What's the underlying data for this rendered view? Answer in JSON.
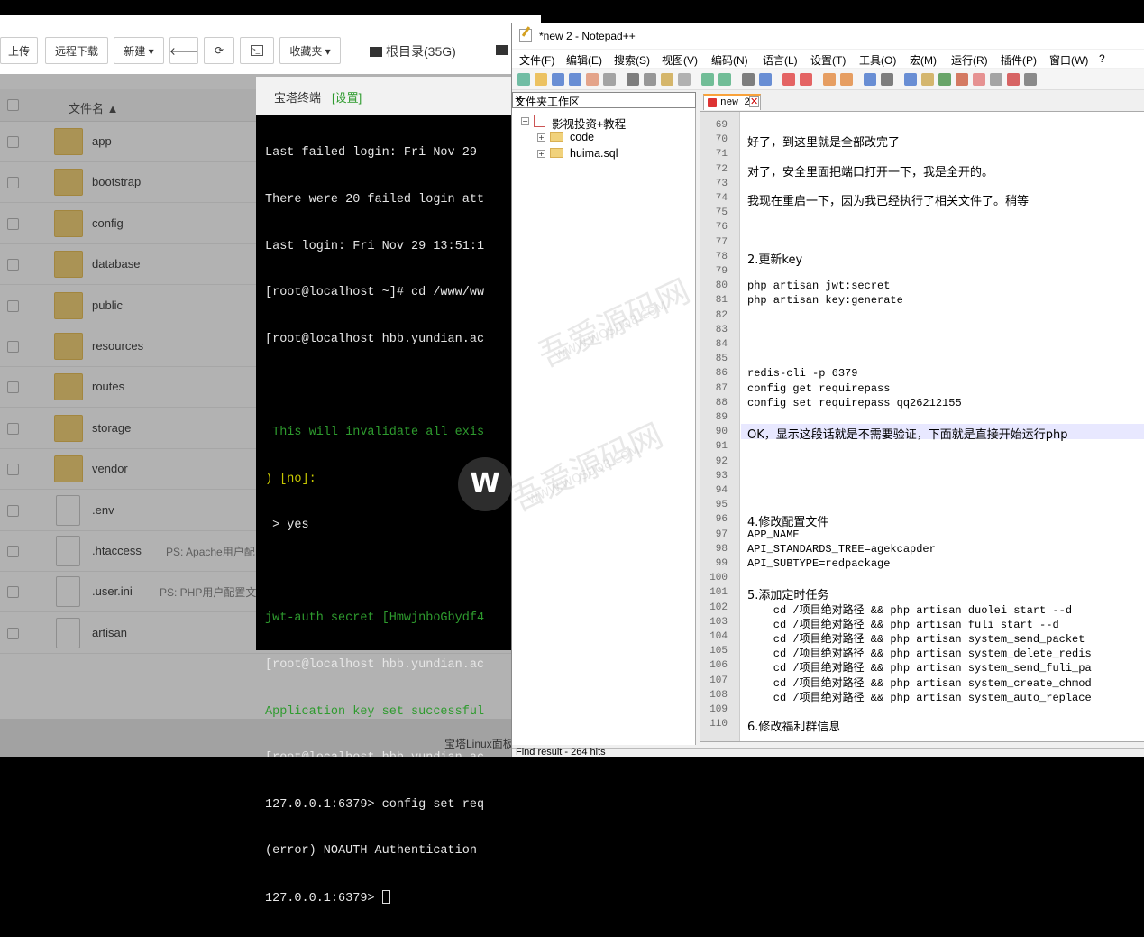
{
  "file_manager": {
    "toolbar": {
      "upload": "上传",
      "remote_download": "远程下载",
      "new": "新建 ▾",
      "favorites": "收藏夹 ▾",
      "root_dir": "根目录(35G)"
    },
    "header_name": "文件名 ▲",
    "rows": [
      {
        "name": "app",
        "type": "folder",
        "ps": ""
      },
      {
        "name": "bootstrap",
        "type": "folder",
        "ps": ""
      },
      {
        "name": "config",
        "type": "folder",
        "ps": ""
      },
      {
        "name": "database",
        "type": "folder",
        "ps": ""
      },
      {
        "name": "public",
        "type": "folder",
        "ps": ""
      },
      {
        "name": "resources",
        "type": "folder",
        "ps": ""
      },
      {
        "name": "routes",
        "type": "folder",
        "ps": ""
      },
      {
        "name": "storage",
        "type": "folder",
        "ps": ""
      },
      {
        "name": "vendor",
        "type": "folder",
        "ps": ""
      },
      {
        "name": ".env",
        "type": "file",
        "ps": ""
      },
      {
        "name": ".htaccess",
        "type": "file",
        "ps": "PS: Apache用户配"
      },
      {
        "name": ".user.ini",
        "type": "file",
        "ps": "PS: PHP用户配置文"
      },
      {
        "name": "artisan",
        "type": "file",
        "ps": ""
      }
    ],
    "footer": "宝塔Linux面板"
  },
  "terminal": {
    "title": "宝塔终端",
    "settings": "[设置]",
    "lines": [
      "Last failed login: Fri Nov 29",
      "There were 20 failed login att",
      "Last login: Fri Nov 29 13:51:1",
      "[root@localhost ~]# cd /www/ww",
      "[root@localhost hbb.yundian.ac",
      "",
      " This will invalidate all exis",
      ") [no]:",
      " > yes",
      "",
      "jwt-auth secret [HmwjnboGbydf4",
      "[root@localhost hbb.yundian.ac",
      "Application key set successful",
      "[root@localhost hbb.yundian.ac",
      "127.0.0.1:6379> config set req",
      "(error) NOAUTH Authentication",
      "127.0.0.1:6379> "
    ]
  },
  "notepad": {
    "title": "*new 2 - Notepad++",
    "menus": [
      "文件(F)",
      "编辑(E)",
      "搜索(S)",
      "视图(V)",
      "编码(N)",
      "语言(L)",
      "设置(T)",
      "工具(O)",
      "宏(M)",
      "运行(R)",
      "插件(P)",
      "窗口(W)",
      "?"
    ],
    "folder_panel_title": "文件夹工作区",
    "tree": {
      "root": "影视投资+教程",
      "children": [
        "code",
        "huima.sql"
      ]
    },
    "tab": "new 2",
    "status": "Find result - 264 hits",
    "lines": [
      {
        "n": "69",
        "t": ""
      },
      {
        "n": "70",
        "t": "好了，到这里就是全部改完了"
      },
      {
        "n": "71",
        "t": ""
      },
      {
        "n": "72",
        "t": "对了，安全里面把端口打开一下，我是全开的。"
      },
      {
        "n": "73",
        "t": ""
      },
      {
        "n": "74",
        "t": "我现在重启一下，因为我已经执行了相关文件了。稍等"
      },
      {
        "n": "75",
        "t": ""
      },
      {
        "n": "76",
        "t": ""
      },
      {
        "n": "77",
        "t": ""
      },
      {
        "n": "78",
        "t": "2.更新key"
      },
      {
        "n": "79",
        "t": ""
      },
      {
        "n": "80",
        "t": "php artisan jwt:secret"
      },
      {
        "n": "81",
        "t": "php artisan key:generate"
      },
      {
        "n": "82",
        "t": ""
      },
      {
        "n": "83",
        "t": ""
      },
      {
        "n": "84",
        "t": ""
      },
      {
        "n": "85",
        "t": ""
      },
      {
        "n": "86",
        "t": "redis-cli -p 6379"
      },
      {
        "n": "87",
        "t": "config get requirepass"
      },
      {
        "n": "88",
        "t": "config set requirepass qq26212155"
      },
      {
        "n": "89",
        "t": ""
      },
      {
        "n": "90",
        "t": "OK，显示这段话就是不需要验证，下面就是直接开始运行php"
      },
      {
        "n": "91",
        "t": ""
      },
      {
        "n": "92",
        "t": ""
      },
      {
        "n": "93",
        "t": ""
      },
      {
        "n": "94",
        "t": ""
      },
      {
        "n": "95",
        "t": ""
      },
      {
        "n": "96",
        "t": "4.修改配置文件"
      },
      {
        "n": "97",
        "t": "APP_NAME"
      },
      {
        "n": "98",
        "t": "API_STANDARDS_TREE=agekcapder"
      },
      {
        "n": "99",
        "t": "API_SUBTYPE=redpackage"
      },
      {
        "n": "100",
        "t": ""
      },
      {
        "n": "101",
        "t": "5.添加定时任务"
      },
      {
        "n": "102",
        "t": "    cd /项目绝对路径 && php artisan duolei start --d"
      },
      {
        "n": "103",
        "t": "    cd /项目绝对路径 && php artisan fuli start --d"
      },
      {
        "n": "104",
        "t": "    cd /项目绝对路径 && php artisan system_send_packet"
      },
      {
        "n": "105",
        "t": "    cd /项目绝对路径 && php artisan system_delete_redis"
      },
      {
        "n": "106",
        "t": "    cd /项目绝对路径 && php artisan system_send_fuli_pa"
      },
      {
        "n": "107",
        "t": "    cd /项目绝对路径 && php artisan system_create_chmod"
      },
      {
        "n": "108",
        "t": "    cd /项目绝对路径 && php artisan system_auto_replace"
      },
      {
        "n": "109",
        "t": ""
      },
      {
        "n": "110",
        "t": "6.修改福利群信息"
      }
    ]
  },
  "watermark": {
    "text1": "吾爱源码网",
    "text2": "WWW.WOSUO8.COM",
    "logo": "W"
  }
}
